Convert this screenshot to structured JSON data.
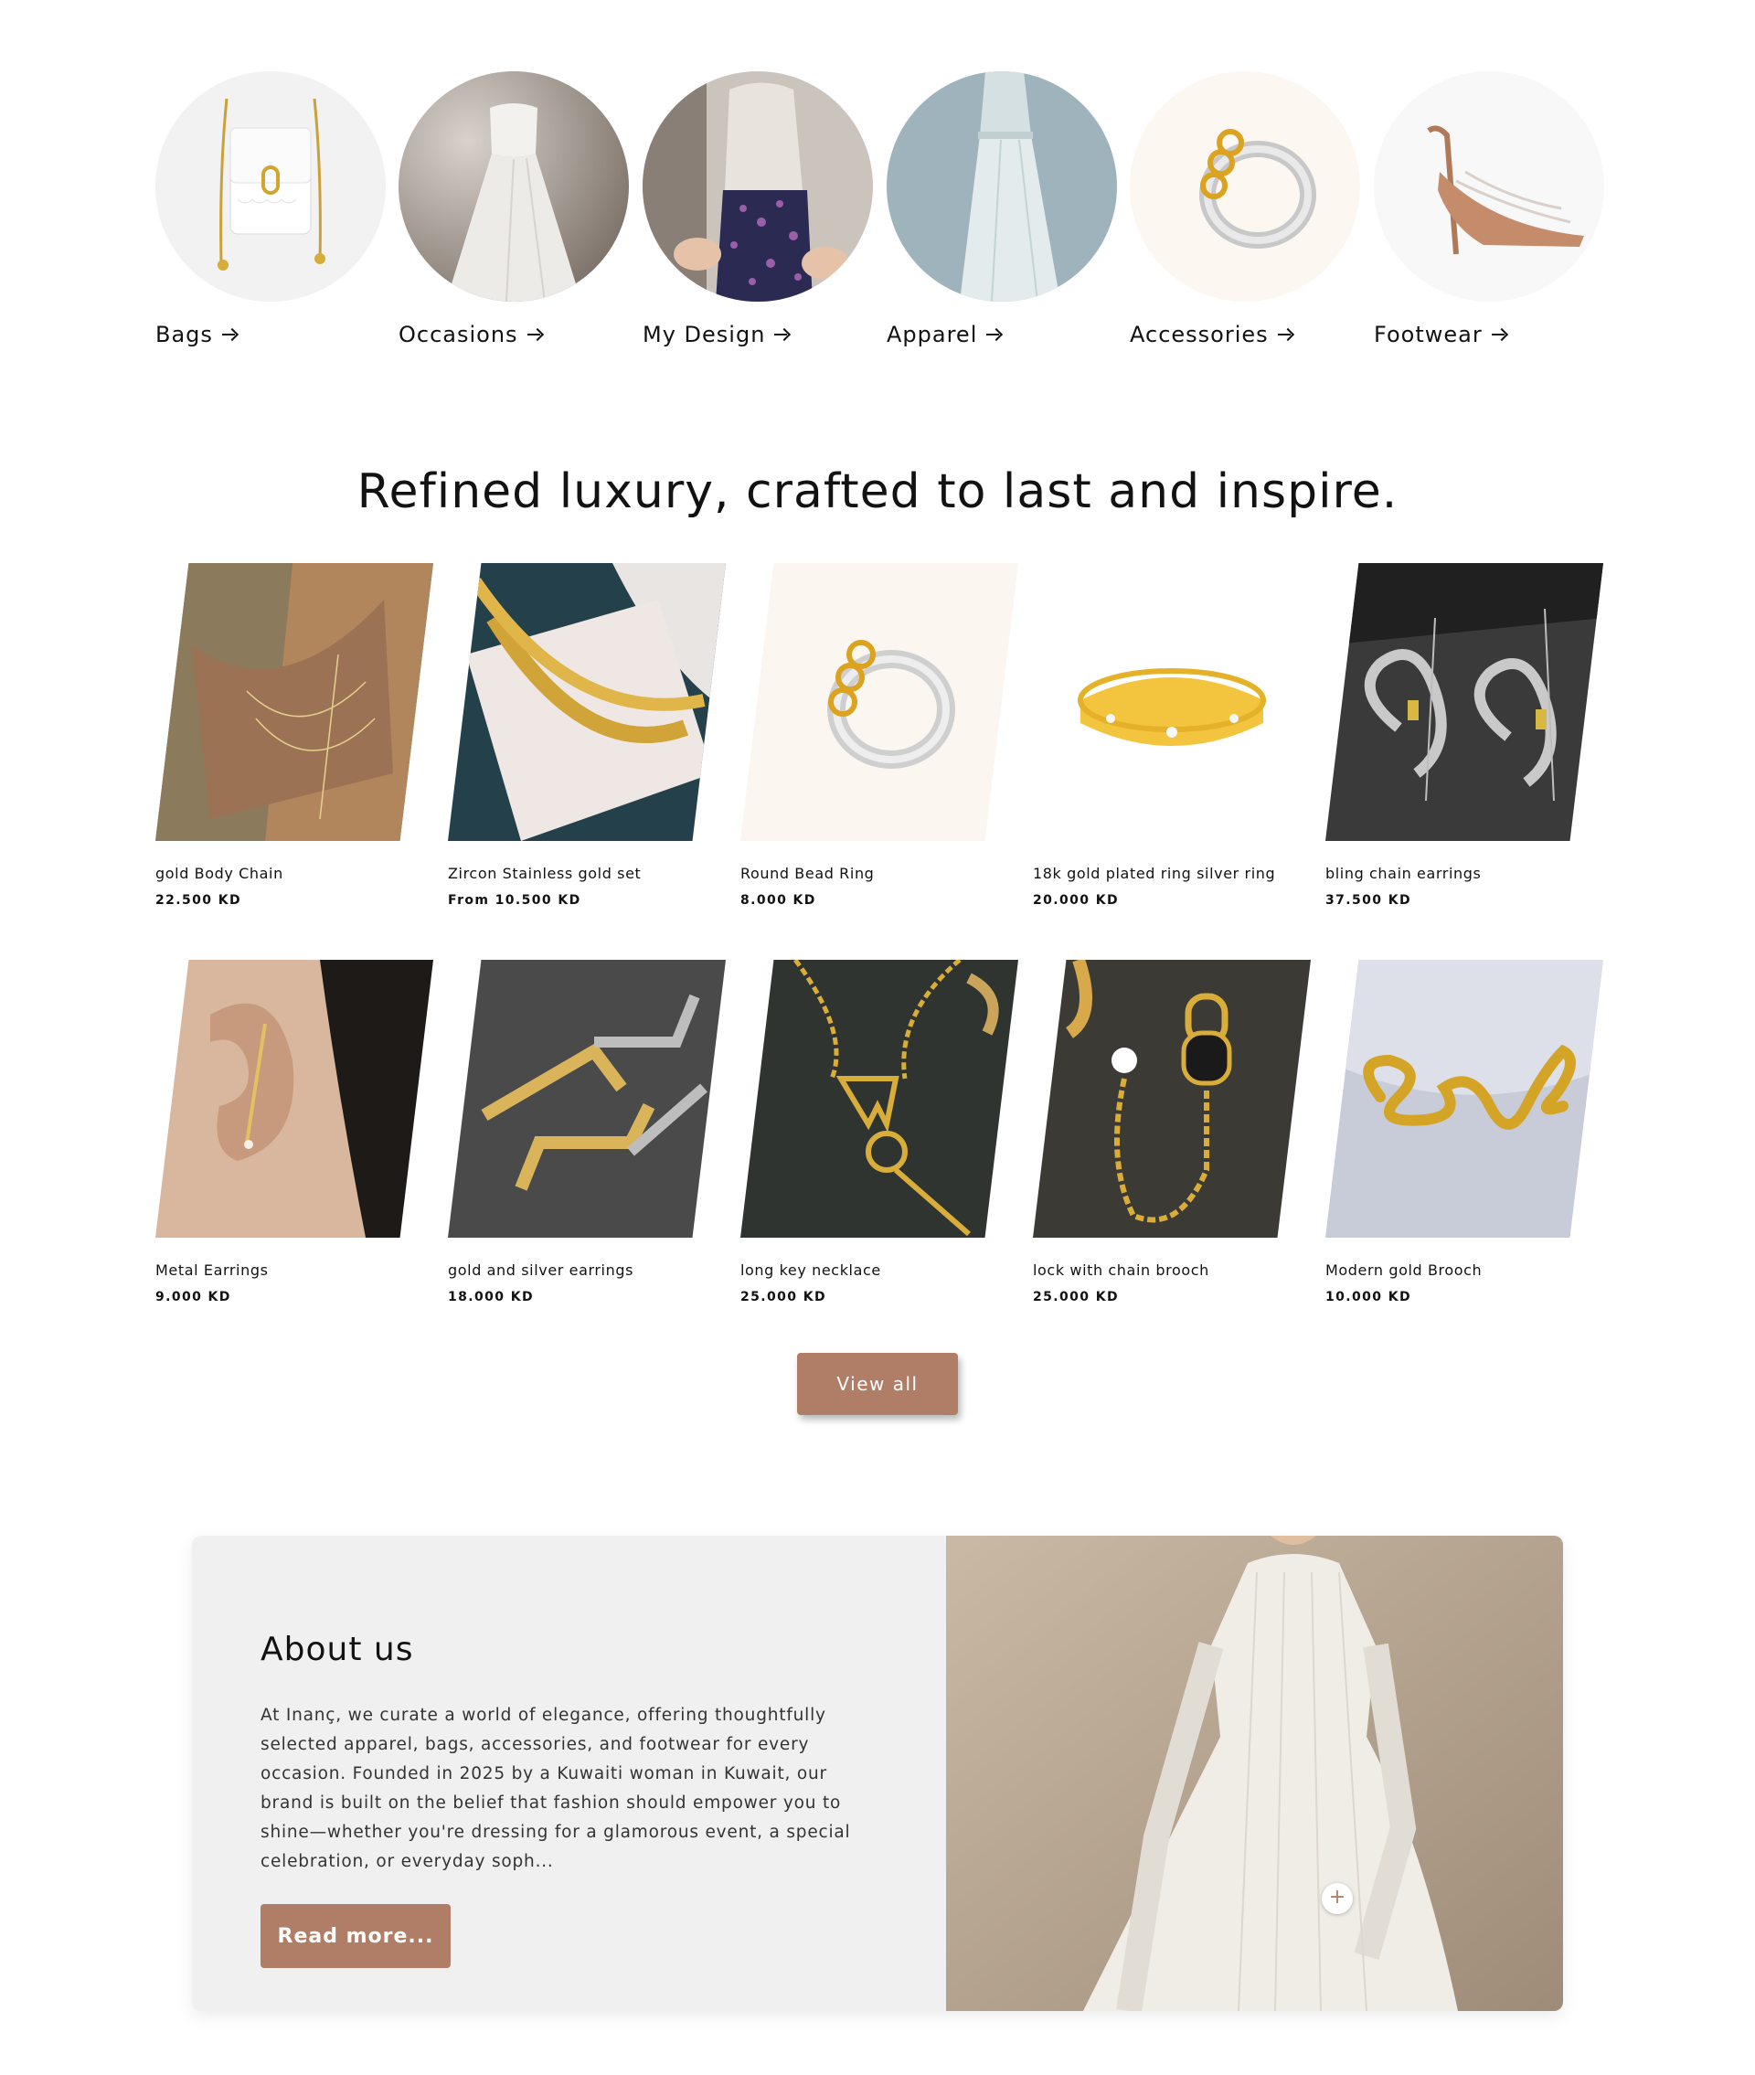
{
  "categories": [
    {
      "label": "Bags",
      "icon": "arrow-right-icon"
    },
    {
      "label": "Occasions",
      "icon": "arrow-right-icon"
    },
    {
      "label": "My Design",
      "icon": "arrow-right-icon"
    },
    {
      "label": "Apparel",
      "icon": "arrow-right-icon"
    },
    {
      "label": "Accessories",
      "icon": "arrow-right-icon"
    },
    {
      "label": "Footwear",
      "icon": "arrow-right-icon"
    }
  ],
  "collection": {
    "heading": "Refined luxury, crafted to last and inspire.",
    "products": [
      {
        "title": "gold Body Chain",
        "price": "22.500 KD"
      },
      {
        "title": "Zircon Stainless gold set",
        "price": "From 10.500 KD"
      },
      {
        "title": "Round Bead Ring",
        "price": "8.000 KD"
      },
      {
        "title": "18k gold plated ring silver ring",
        "price": "20.000 KD"
      },
      {
        "title": "bling chain earrings",
        "price": "37.500 KD"
      },
      {
        "title": "Metal Earrings",
        "price": "9.000 KD"
      },
      {
        "title": "gold and silver earrings",
        "price": "18.000 KD"
      },
      {
        "title": "long key necklace",
        "price": "25.000 KD"
      },
      {
        "title": "lock with chain brooch",
        "price": "25.000 KD"
      },
      {
        "title": "Modern gold Brooch",
        "price": "10.000 KD"
      }
    ],
    "view_all_label": "View all"
  },
  "about": {
    "title": "About us",
    "body": "At Inanç, we curate a world of elegance, offering thoughtfully selected apparel, bags, accessories, and footwear for every occasion. Founded in 2025 by a Kuwaiti woman in Kuwait, our brand is built on the belief that fashion should empower you to shine—whether you're dressing for a glamorous event, a special celebration, or everyday soph...",
    "read_more_label": "Read more...",
    "hotspot_symbol": "+"
  },
  "colors": {
    "accent": "#b07d66",
    "text": "#121212",
    "about_background": "#f0f0f0"
  }
}
